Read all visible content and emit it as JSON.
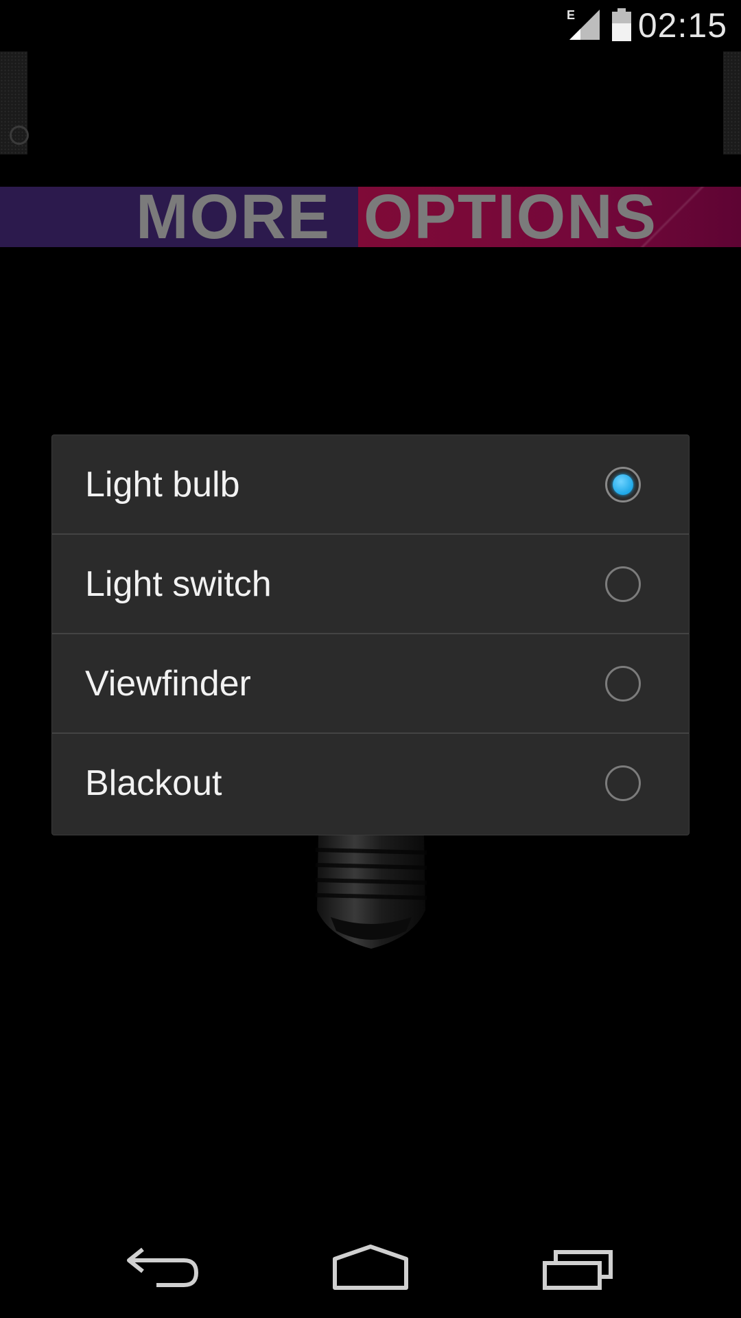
{
  "status_bar": {
    "network_type": "E",
    "time": "02:15",
    "icons": [
      "signal-icon",
      "battery-icon"
    ]
  },
  "banner": {
    "word_1": "MORE",
    "word_2": "OPTIONS",
    "colors": {
      "left": "#2c1a4d",
      "right": "#7f0a37",
      "text": "#7b7b7b"
    }
  },
  "dialog": {
    "options": [
      {
        "label": "Light bulb",
        "selected": true
      },
      {
        "label": "Light switch",
        "selected": false
      },
      {
        "label": "Viewfinder",
        "selected": false
      },
      {
        "label": "Blackout",
        "selected": false
      }
    ],
    "accent_color": "#1ea8e8"
  },
  "nav_bar": {
    "buttons": [
      "back-icon",
      "home-icon",
      "recent-apps-icon"
    ]
  }
}
